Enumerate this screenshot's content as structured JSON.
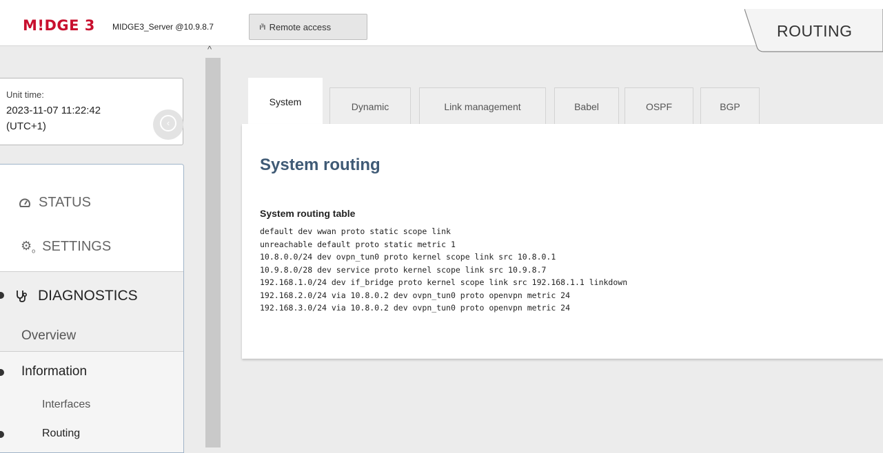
{
  "header": {
    "logo": "M!DGE 3",
    "server": "MIDGE3_Server @10.9.8.7",
    "remote_access": "Remote access",
    "page_title": "ROUTING"
  },
  "unit_time": {
    "label": "Unit time:",
    "datetime": "2023-11-07 11:22:42",
    "timezone": "(UTC+1)"
  },
  "menu": {
    "status": "STATUS",
    "settings": "SETTINGS",
    "diagnostics": "DIAGNOSTICS",
    "overview": "Overview",
    "information": "Information",
    "interfaces": "Interfaces",
    "routing": "Routing"
  },
  "tabs": [
    {
      "label": "System",
      "active": true
    },
    {
      "label": "Dynamic"
    },
    {
      "label": "Link management"
    },
    {
      "label": "Babel"
    },
    {
      "label": "OSPF"
    },
    {
      "label": "BGP"
    }
  ],
  "content": {
    "title": "System routing",
    "table_title": "System routing table",
    "routes": [
      "default dev wwan proto static scope link",
      "unreachable default proto static metric 1",
      "10.8.0.0/24 dev ovpn_tun0 proto kernel scope link src 10.8.0.1",
      "10.9.8.0/28 dev service proto kernel scope link src 10.9.8.7",
      "192.168.1.0/24 dev if_bridge proto kernel scope link src 192.168.1.1 linkdown",
      "192.168.2.0/24 via 10.8.0.2 dev ovpn_tun0 proto openvpn metric 24",
      "192.168.3.0/24 via 10.8.0.2 dev ovpn_tun0 proto openvpn metric 24"
    ]
  },
  "colors": {
    "brand": "#c8102e",
    "title": "#3f5a75"
  }
}
